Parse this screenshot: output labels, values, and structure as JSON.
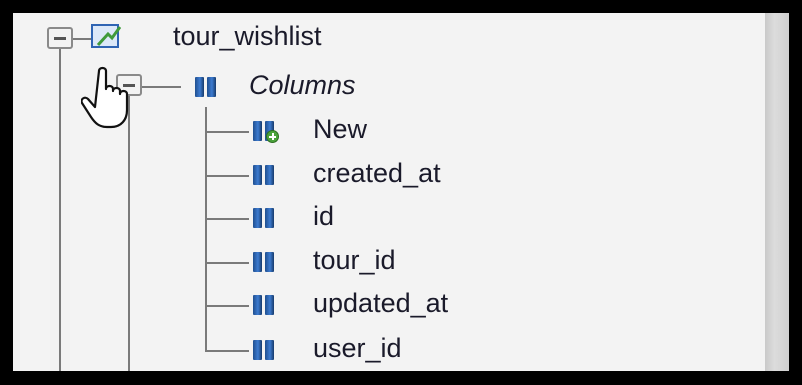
{
  "tree": {
    "table": {
      "label": "tour_wishlist",
      "expanded": true,
      "icon": "table-icon"
    },
    "columns_group": {
      "label": "Columns",
      "expanded": true,
      "icon": "columns-icon"
    },
    "new_item": {
      "label": "New",
      "icon": "new-column-icon"
    },
    "columns": [
      {
        "label": "created_at",
        "icon": "column-icon"
      },
      {
        "label": "id",
        "icon": "column-icon"
      },
      {
        "label": "tour_id",
        "icon": "column-icon"
      },
      {
        "label": "updated_at",
        "icon": "column-icon"
      },
      {
        "label": "user_id",
        "icon": "column-icon"
      }
    ]
  },
  "colors": {
    "column_icon": "#2f64b3",
    "new_badge": "#4aa23a",
    "tree_line": "#7a7a7a",
    "panel_bg": "#f3f3f3"
  }
}
